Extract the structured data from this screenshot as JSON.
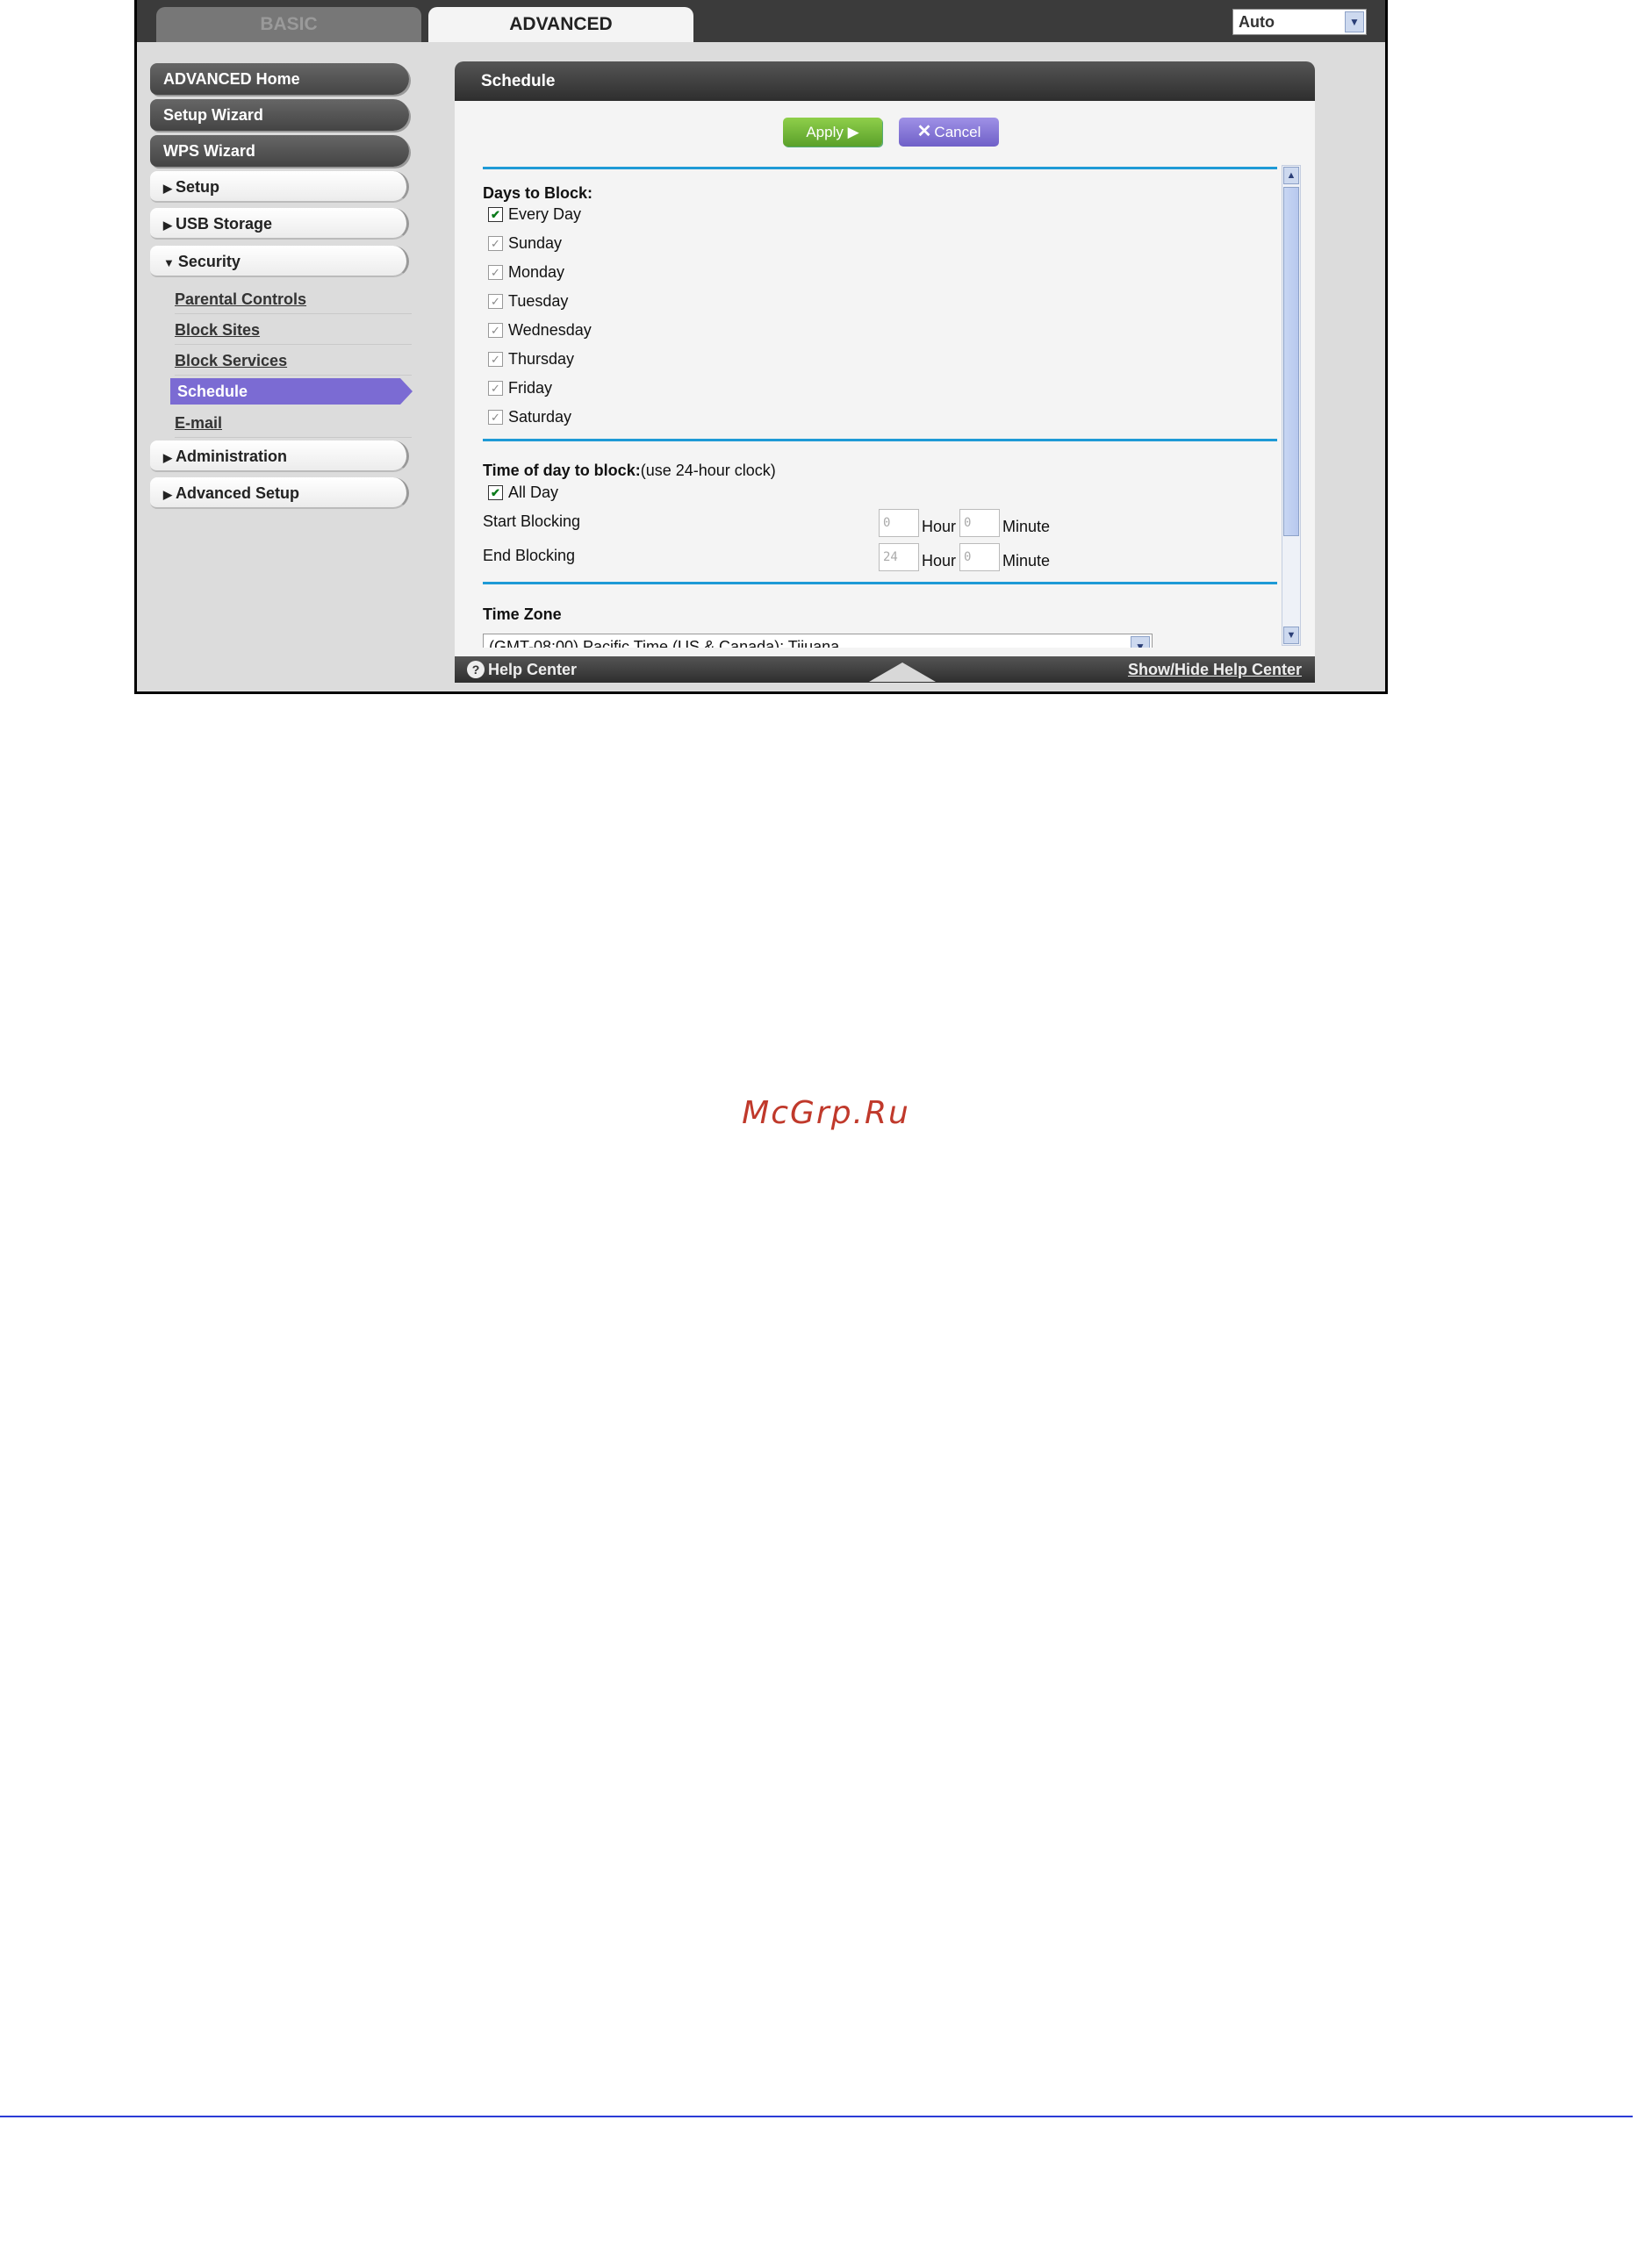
{
  "tabs": {
    "basic": "BASIC",
    "advanced": "ADVANCED"
  },
  "language": {
    "selected": "Auto"
  },
  "nav": {
    "advanced_home": "ADVANCED Home",
    "setup_wizard": "Setup Wizard",
    "wps_wizard": "WPS Wizard",
    "setup": "Setup",
    "usb_storage": "USB Storage",
    "security": "Security",
    "security_items": {
      "parental_controls": "Parental Controls",
      "block_sites": "Block Sites",
      "block_services": "Block Services",
      "schedule": "Schedule",
      "email": "E-mail"
    },
    "administration": "Administration",
    "advanced_setup": "Advanced Setup"
  },
  "panel": {
    "title": "Schedule",
    "apply_label": "Apply ▶",
    "cancel_label": "Cancel"
  },
  "days": {
    "heading": "Days to Block:",
    "every_day": {
      "label": "Every Day",
      "checked": true
    },
    "items": [
      {
        "label": "Sunday",
        "checked": true
      },
      {
        "label": "Monday",
        "checked": true
      },
      {
        "label": "Tuesday",
        "checked": true
      },
      {
        "label": "Wednesday",
        "checked": true
      },
      {
        "label": "Thursday",
        "checked": true
      },
      {
        "label": "Friday",
        "checked": true
      },
      {
        "label": "Saturday",
        "checked": true
      }
    ]
  },
  "time": {
    "heading": "Time of day to block:",
    "heading_note": "(use 24-hour clock)",
    "all_day": {
      "label": "All Day",
      "checked": true
    },
    "start_label": "Start Blocking",
    "end_label": "End Blocking",
    "start_hour": "0",
    "start_minute": "0",
    "end_hour": "24",
    "end_minute": "0",
    "hour_unit": "Hour",
    "minute_unit": "Minute"
  },
  "timezone": {
    "heading": "Time Zone",
    "selected": "(GMT-08:00) Pacific Time (US & Canada); Tijuana"
  },
  "footer": {
    "help_center": "Help Center",
    "show_hide": "Show/Hide Help Center"
  },
  "watermark": "McGrp.Ru",
  "colors": {
    "accent_blue": "#1e9ad6",
    "apply_green": "#6bb52f",
    "cancel_purple": "#7b6bd3",
    "selected_nav": "#7b6bd3"
  }
}
